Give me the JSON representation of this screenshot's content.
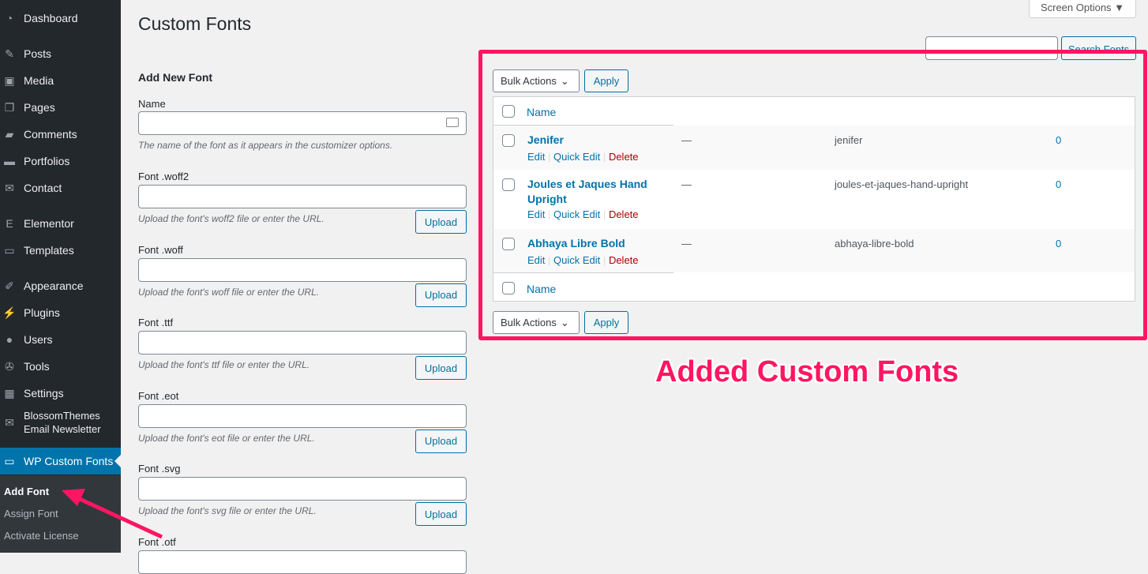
{
  "sidebar": {
    "items": [
      {
        "label": "Dashboard",
        "icon": "dashboard-icon"
      },
      {
        "label": "Posts",
        "icon": "pin-icon"
      },
      {
        "label": "Media",
        "icon": "media-icon"
      },
      {
        "label": "Pages",
        "icon": "pages-icon"
      },
      {
        "label": "Comments",
        "icon": "comment-icon"
      },
      {
        "label": "Portfolios",
        "icon": "folder-icon"
      },
      {
        "label": "Contact",
        "icon": "mail-icon"
      },
      {
        "label": "Elementor",
        "icon": "elementor-icon"
      },
      {
        "label": "Templates",
        "icon": "folder-open-icon"
      },
      {
        "label": "Appearance",
        "icon": "brush-icon"
      },
      {
        "label": "Plugins",
        "icon": "plugin-icon"
      },
      {
        "label": "Users",
        "icon": "user-icon"
      },
      {
        "label": "Tools",
        "icon": "wrench-icon"
      },
      {
        "label": "Settings",
        "icon": "settings-icon"
      },
      {
        "label": "BlossomThemes Email Newsletter",
        "icon": "newsletter-icon"
      },
      {
        "label": "WP Custom Fonts",
        "icon": "folder-open-icon"
      }
    ],
    "submenu": [
      "Add Font",
      "Assign Font",
      "Activate License"
    ]
  },
  "header": {
    "title": "Custom Fonts",
    "screen_options": "Screen Options ▼"
  },
  "form": {
    "heading": "Add New Font",
    "name_label": "Name",
    "name_desc": "The name of the font as it appears in the customizer options.",
    "fields": [
      {
        "label": "Font .woff2",
        "desc": "Upload the font's woff2 file or enter the URL."
      },
      {
        "label": "Font .woff",
        "desc": "Upload the font's woff file or enter the URL."
      },
      {
        "label": "Font .ttf",
        "desc": "Upload the font's ttf file or enter the URL."
      },
      {
        "label": "Font .eot",
        "desc": "Upload the font's eot file or enter the URL."
      },
      {
        "label": "Font .svg",
        "desc": "Upload the font's svg file or enter the URL."
      },
      {
        "label": "Font .otf",
        "desc": ""
      }
    ],
    "upload": "Upload"
  },
  "list": {
    "search_button": "Search Fonts",
    "bulk_actions": "Bulk Actions",
    "apply": "Apply",
    "col_name": "Name",
    "rows": [
      {
        "name": "Jenifer",
        "desc": "—",
        "slug": "jenifer",
        "count": "0"
      },
      {
        "name": "Joules et Jaques Hand Upright",
        "desc": "—",
        "slug": "joules-et-jaques-hand-upright",
        "count": "0"
      },
      {
        "name": "Abhaya Libre Bold",
        "desc": "—",
        "slug": "abhaya-libre-bold",
        "count": "0"
      }
    ],
    "edit": "Edit",
    "quick_edit": "Quick Edit",
    "delete": "Delete",
    "sep": "|"
  },
  "annotation": {
    "caption": "Added Custom Fonts",
    "color": "#ff1662"
  }
}
